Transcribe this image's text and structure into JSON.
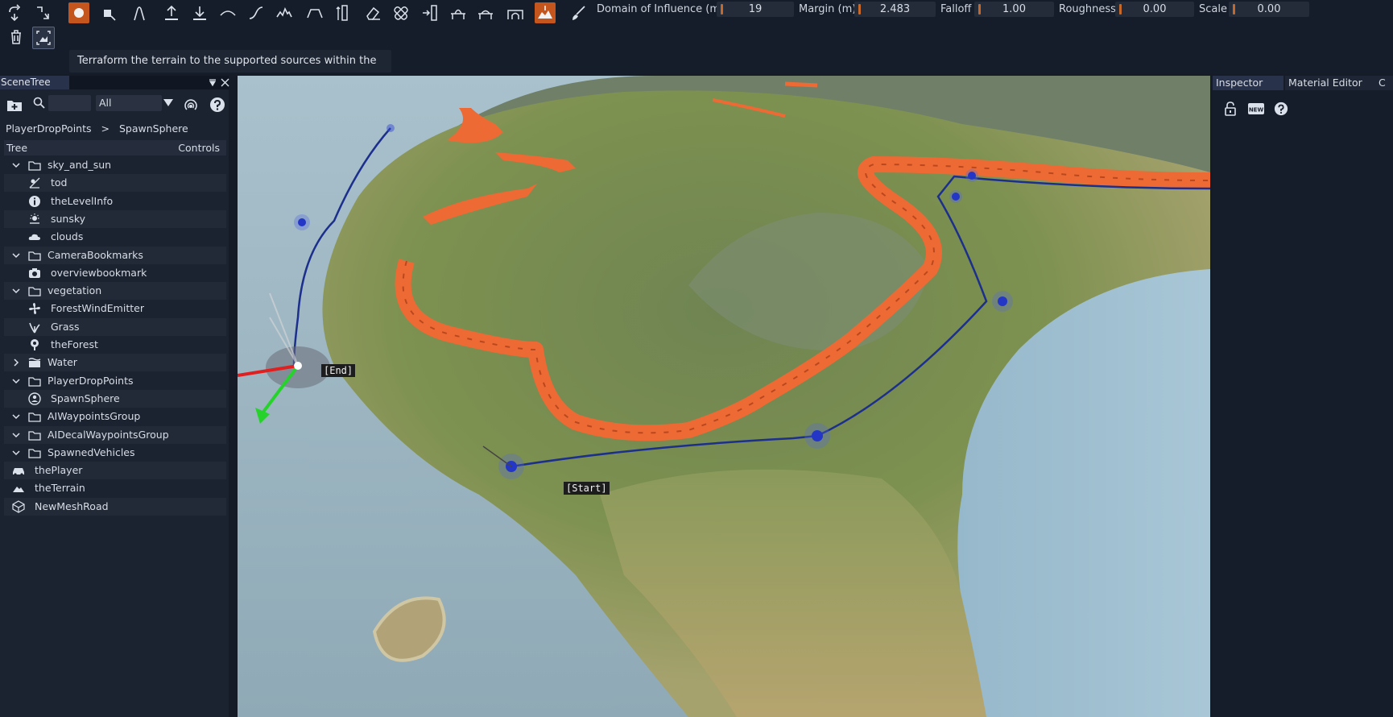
{
  "toolbar": {
    "params": [
      {
        "label": "Domain of Influence (m)",
        "value": "19"
      },
      {
        "label": "Margin (m)",
        "value": "2.483"
      },
      {
        "label": "Falloff",
        "value": "1.00"
      },
      {
        "label": "Roughness",
        "value": "0.00"
      },
      {
        "label": "Scale",
        "value": "0.00"
      }
    ],
    "tooltip": "Terraform the terrain to the supported sources within the polygon.",
    "accent": "#c4561d"
  },
  "scenetree": {
    "tab": "SceneTree",
    "filter_value": "All",
    "breadcrumb": [
      "PlayerDropPoints",
      ">",
      "SpawnSphere"
    ],
    "columns": [
      "Tree",
      "Controls"
    ],
    "items": [
      {
        "label": "sky_and_sun",
        "icon": "folder-icon",
        "level": 1,
        "expanded": true
      },
      {
        "label": "tod",
        "icon": "time-of-day-icon",
        "level": 2
      },
      {
        "label": "theLevelInfo",
        "icon": "info-icon",
        "level": 2
      },
      {
        "label": "sunsky",
        "icon": "sun-icon",
        "level": 2
      },
      {
        "label": "clouds",
        "icon": "cloud-icon",
        "level": 2
      },
      {
        "label": "CameraBookmarks",
        "icon": "folder-icon",
        "level": 1,
        "expanded": true
      },
      {
        "label": "overviewbookmark",
        "icon": "camera-icon",
        "level": 2
      },
      {
        "label": "vegetation",
        "icon": "folder-icon",
        "level": 1,
        "expanded": true
      },
      {
        "label": "ForestWindEmitter",
        "icon": "fan-icon",
        "level": 2
      },
      {
        "label": "Grass",
        "icon": "grass-icon",
        "level": 2
      },
      {
        "label": "theForest",
        "icon": "tree-icon",
        "level": 2
      },
      {
        "label": "Water",
        "icon": "water-icon",
        "level": 1,
        "expanded": false
      },
      {
        "label": "PlayerDropPoints",
        "icon": "folder-icon",
        "level": 1,
        "expanded": true
      },
      {
        "label": "SpawnSphere",
        "icon": "spawn-icon",
        "level": 2
      },
      {
        "label": "AIWaypointsGroup",
        "icon": "folder-icon",
        "level": 1,
        "expanded": true
      },
      {
        "label": "AIDecalWaypointsGroup",
        "icon": "folder-icon",
        "level": 1,
        "expanded": true
      },
      {
        "label": "SpawnedVehicles",
        "icon": "folder-icon",
        "level": 1,
        "expanded": true
      },
      {
        "label": "thePlayer",
        "icon": "car-icon",
        "level": 0
      },
      {
        "label": "theTerrain",
        "icon": "terrain-icon",
        "level": 0
      },
      {
        "label": "NewMeshRoad",
        "icon": "mesh-icon",
        "level": 0
      }
    ]
  },
  "viewport": {
    "labels": {
      "end": "[End]",
      "start": "[Start]"
    }
  },
  "inspector": {
    "tabs": [
      "Inspector",
      "Material Editor",
      "C"
    ]
  }
}
